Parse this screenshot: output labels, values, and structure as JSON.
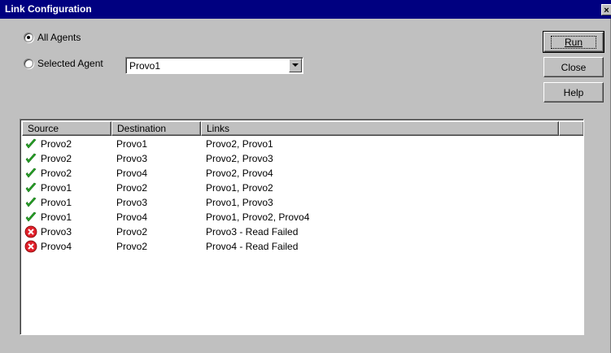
{
  "window": {
    "title": "Link Configuration",
    "close_glyph": "×"
  },
  "mode": {
    "all_agents_label": "All Agents",
    "selected_agent_label": "Selected Agent",
    "selected": "all_agents"
  },
  "agent_select": {
    "value": "Provo1"
  },
  "buttons": {
    "run": "Run",
    "close": "Close",
    "help": "Help"
  },
  "columns": [
    "Source",
    "Destination",
    "Links",
    ""
  ],
  "rows": [
    {
      "status": "ok",
      "source": "Provo2",
      "destination": "Provo1",
      "links": "Provo2, Provo1"
    },
    {
      "status": "ok",
      "source": "Provo2",
      "destination": "Provo3",
      "links": "Provo2, Provo3"
    },
    {
      "status": "ok",
      "source": "Provo2",
      "destination": "Provo4",
      "links": "Provo2, Provo4"
    },
    {
      "status": "ok",
      "source": "Provo1",
      "destination": "Provo2",
      "links": "Provo1, Provo2"
    },
    {
      "status": "ok",
      "source": "Provo1",
      "destination": "Provo3",
      "links": "Provo1, Provo3"
    },
    {
      "status": "ok",
      "source": "Provo1",
      "destination": "Provo4",
      "links": "Provo1, Provo2, Provo4"
    },
    {
      "status": "error",
      "source": "Provo3",
      "destination": "Provo2",
      "links": "Provo3 - Read Failed"
    },
    {
      "status": "error",
      "source": "Provo4",
      "destination": "Provo2",
      "links": "Provo4 - Read Failed"
    }
  ],
  "icons": {
    "ok": "green-checkmark-icon",
    "error": "red-x-circle-icon"
  },
  "colors": {
    "titlebar": "#000080",
    "ok": "#2aa52a",
    "error": "#e0202a",
    "face": "#c0c0c0"
  }
}
